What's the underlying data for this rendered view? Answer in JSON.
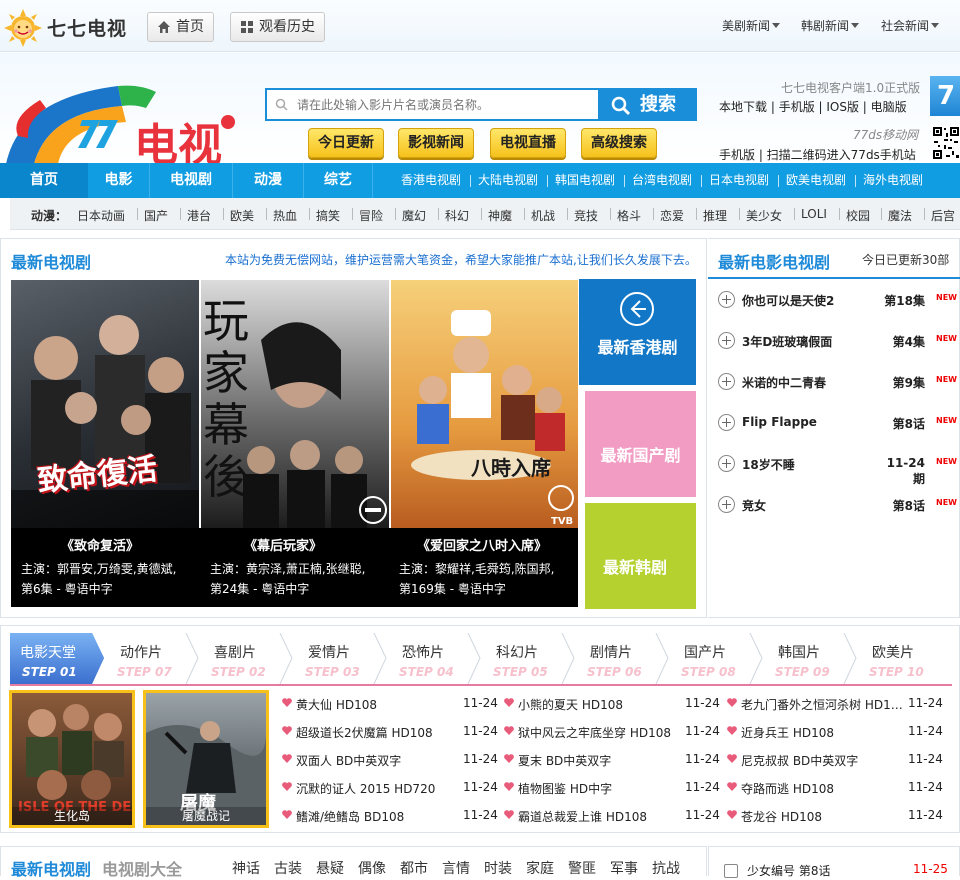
{
  "topbar": {
    "logo_text": "七七电视",
    "home_label": "首页",
    "history_label": "观看历史",
    "nav": [
      "美剧新闻",
      "韩剧新闻",
      "社会新闻"
    ]
  },
  "header": {
    "client_line": "七七电视客户端1.0正式版",
    "downloads": [
      "本地下载",
      "手机版",
      "IOS版",
      "电脑版"
    ],
    "mobile_site": "77ds移动网",
    "mobile_line": "手机版 | 扫描二维码进入77ds手机站",
    "search_placeholder": "请在此处输入影片片名或演员名称。",
    "search_btn": "搜索",
    "yellow_btns": [
      "今日更新",
      "影视新闻",
      "电视直播",
      "高级搜索"
    ]
  },
  "mainnav": {
    "items": [
      "首页",
      "电影",
      "电视剧",
      "动漫",
      "综艺"
    ],
    "subitems": [
      "香港电视剧",
      "大陆电视剧",
      "韩国电视剧",
      "台湾电视剧",
      "日本电视剧",
      "欧美电视剧",
      "海外电视剧"
    ]
  },
  "catbar": {
    "label": "动漫：",
    "items": [
      "日本动画",
      "国产",
      "港台",
      "欧美",
      "热血",
      "搞笑",
      "冒险",
      "魔幻",
      "科幻",
      "神魔",
      "机战",
      "竞技",
      "格斗",
      "恋爱",
      "推理",
      "美少女",
      "LOLI",
      "校园",
      "魔法",
      "后宫"
    ]
  },
  "latest_tv": {
    "title": "最新电视剧",
    "notice": "本站为免费无偿网站，维护运营需大笔资金，希望大家能推广本站,让我们长久发展下去。",
    "shows": [
      {
        "title": "《致命复活》",
        "cast": "主演：郭晋安,万绮雯,黄德斌,",
        "ep": "第6集 - 粤语中字",
        "poster_text": "致命復活"
      },
      {
        "title": "《幕后玩家》",
        "cast": "主演：黄宗泽,萧正楠,张继聪,",
        "ep": "第24集 - 粤语中字",
        "poster_text": "玩家 幕後"
      },
      {
        "title": "《爱回家之八时入席》",
        "cast": "主演：黎耀祥,毛舜筠,陈国邦,",
        "ep": "第169集 - 粤语中字",
        "poster_text": "八時入席"
      }
    ],
    "tiles": [
      "最新香港剧",
      "最新国产剧",
      "最新韩剧"
    ],
    "tile_colors": [
      "#1277c7",
      "#f29bc3",
      "#b5d130"
    ]
  },
  "latest_movies_tv": {
    "title": "最新电影电视剧",
    "updated": "今日已更新30部",
    "items": [
      {
        "name": "你也可以是天使2",
        "ep": "第18集",
        "badge": "NEW"
      },
      {
        "name": "3年D班玻璃假面",
        "ep": "第4集",
        "badge": "NEW"
      },
      {
        "name": "米诺的中二青春",
        "ep": "第9集",
        "badge": "NEW"
      },
      {
        "name": "Flip Flappe",
        "ep": "第8话",
        "badge": "NEW"
      },
      {
        "name": "18岁不睡",
        "ep": "11-24期",
        "badge": "NEW"
      },
      {
        "name": "竞女",
        "ep": "第8话",
        "badge": "NEW"
      }
    ]
  },
  "movie_steps": [
    {
      "name": "电影天堂",
      "step": "STEP 01"
    },
    {
      "name": "动作片",
      "step": "STEP 07"
    },
    {
      "name": "喜剧片",
      "step": "STEP 02"
    },
    {
      "name": "爱情片",
      "step": "STEP 03"
    },
    {
      "name": "恐怖片",
      "step": "STEP 04"
    },
    {
      "name": "科幻片",
      "step": "STEP 05"
    },
    {
      "name": "剧情片",
      "step": "STEP 06"
    },
    {
      "name": "国产片",
      "step": "STEP 08"
    },
    {
      "name": "韩国片",
      "step": "STEP 09"
    },
    {
      "name": "欧美片",
      "step": "STEP 10"
    }
  ],
  "movie_posters": [
    "生化岛",
    "屠魔战记"
  ],
  "movie_list": [
    [
      {
        "t": "黄大仙  HD108",
        "d": "11-24"
      },
      {
        "t": "超级道长2伏魔篇  HD108",
        "d": "11-24"
      },
      {
        "t": "双面人  BD中英双字",
        "d": "11-24"
      },
      {
        "t": "沉默的证人 2015  HD720",
        "d": "11-24"
      },
      {
        "t": "鳍滩/绝鳍岛  BD108",
        "d": "11-24"
      }
    ],
    [
      {
        "t": "小熊的夏天  HD108",
        "d": "11-24"
      },
      {
        "t": "狱中风云之牢底坐穿  HD108",
        "d": "11-24"
      },
      {
        "t": "夏末  BD中英双字",
        "d": "11-24"
      },
      {
        "t": "植物图鉴  HD中字",
        "d": "11-24"
      },
      {
        "t": "霸道总裁爱上谁  HD108",
        "d": "11-24"
      }
    ],
    [
      {
        "t": "老九门番外之恒河杀树  HD1…",
        "d": "11-24"
      },
      {
        "t": "近身兵王  HD108",
        "d": "11-24"
      },
      {
        "t": "尼克叔叔  BD中英双字",
        "d": "11-24"
      },
      {
        "t": "夺路而逃  HD108",
        "d": "11-24"
      },
      {
        "t": "苍龙谷  HD108",
        "d": "11-24"
      }
    ]
  ],
  "bottom": {
    "title": "最新电视剧",
    "subtitle": "电视剧大全",
    "genres": [
      "神话",
      "古装",
      "悬疑",
      "偶像",
      "都市",
      "言情",
      "时装",
      "家庭",
      "警匪",
      "军事",
      "抗战"
    ],
    "right_item": "少女编号  第8话",
    "right_date": "11-25"
  },
  "colors": {
    "brand_blue": "#119de2",
    "accent_yellow": "#f6c21c",
    "step_pink": "#e57ba1"
  }
}
